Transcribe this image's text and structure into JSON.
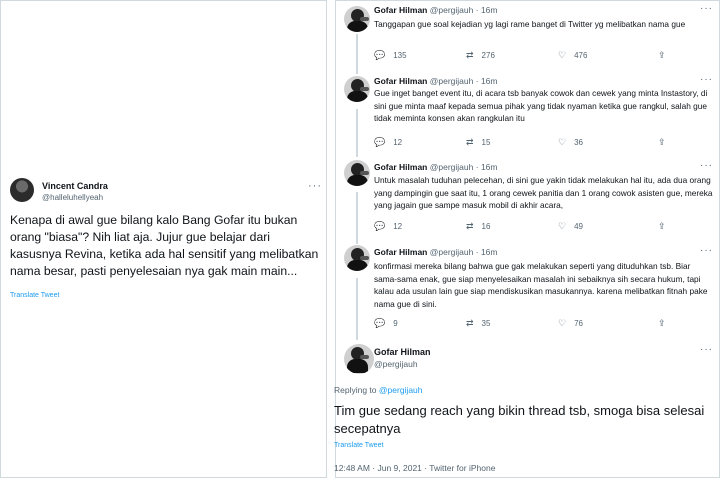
{
  "left_tweet": {
    "name": "Vincent Candra",
    "handle": "@halleluhellyeah",
    "more_icon": "more-dots-icon",
    "text": "Kenapa di awal gue bilang kalo Bang Gofar itu bukan orang \"biasa\"? Nih liat aja. Jujur gue belajar dari kasusnya Revina, ketika ada hal sensitif yang melibatkan nama besar, pasti penyelesaian nya gak main main...",
    "translate": "Translate Tweet"
  },
  "thread": [
    {
      "name": "Gofar Hilman",
      "handle": "@pergijauh",
      "sep": "·",
      "time": "16m",
      "text": "Tanggapan gue soal kejadian yg lagi rame banget di Twitter yg melibatkan nama gue",
      "replies": "135",
      "retweets": "276",
      "likes": "476"
    },
    {
      "name": "Gofar Hilman",
      "handle": "@pergijauh",
      "sep": "·",
      "time": "16m",
      "text": "Gue inget banget event itu, di acara tsb banyak cowok dan cewek yang minta Instastory, di sini gue minta maaf kepada semua pihak yang tidak nyaman ketika gue rangkul, salah gue tidak meminta konsen akan rangkulan itu",
      "replies": "12",
      "retweets": "15",
      "likes": "36"
    },
    {
      "name": "Gofar Hilman",
      "handle": "@pergijauh",
      "sep": "·",
      "time": "16m",
      "text": "Untuk masalah tuduhan pelecehan, di sini gue yakin tidak melakukan hal itu, ada dua orang yang dampingin gue saat itu, 1 orang cewek panitia dan 1 orang cowok asisten gue,  mereka yang jagain gue sampe masuk mobil di akhir acara,",
      "replies": "12",
      "retweets": "16",
      "likes": "49"
    },
    {
      "name": "Gofar Hilman",
      "handle": "@pergijauh",
      "sep": "·",
      "time": "16m",
      "text": "konfirmasi mereka bilang bahwa gue gak melakukan seperti yang dituduhkan tsb. Biar sama-sama enak, gue siap menyelesaikan masalah ini sebaiknya sih secara hukum, tapi kalau ada usulan lain gue siap mendiskusikan masukannya. karena melibatkan fitnah pake nama gue di sini.",
      "replies": "9",
      "retweets": "35",
      "likes": "76"
    }
  ],
  "main_tweet": {
    "name": "Gofar Hilman",
    "handle": "@pergijauh",
    "replying_prefix": "Replying to",
    "replying_to": "@pergijauh",
    "text": "Tim gue sedang reach yang bikin thread tsb, smoga bisa selesai secepatnya",
    "translate": "Translate Tweet",
    "timestamp": "12:48 AM · Jun 9, 2021 · Twitter for iPhone"
  },
  "icons": {
    "reply": "reply-icon",
    "retweet": "retweet-icon",
    "like": "heart-icon",
    "share": "share-icon"
  },
  "colors": {
    "link": "#1d9bf0",
    "secondary": "#536471",
    "text": "#0f1419"
  }
}
